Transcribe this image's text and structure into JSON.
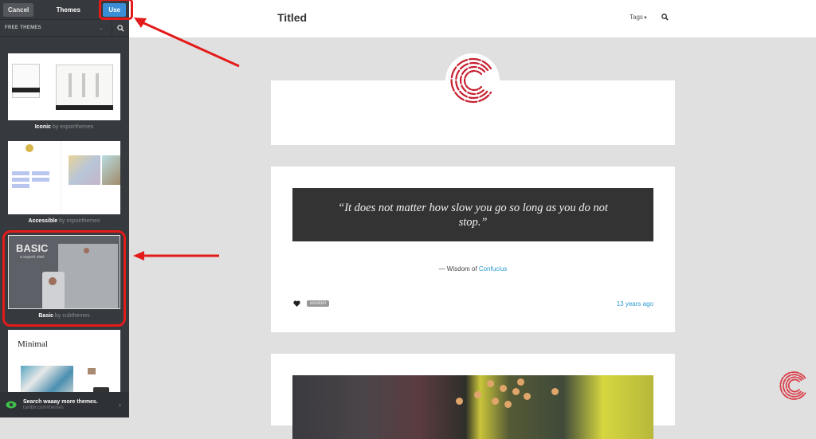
{
  "sidebar": {
    "cancel_label": "Cancel",
    "title": "Themes",
    "use_label": "Use",
    "filter_label": "FREE THEMES",
    "themes": [
      {
        "name": "Iconic",
        "by": "by",
        "author": "espoirthemes"
      },
      {
        "name": "Accessible",
        "by": "by",
        "author": "espoirthemes"
      },
      {
        "name": "Basic",
        "by": "by",
        "author": "cubthemes",
        "thumb_title": "BASIC",
        "thumb_subtitle": "a superb start"
      },
      {
        "name": "Minimal",
        "thumb_title": "Minimal"
      }
    ],
    "promo": {
      "title": "Search waaay more themes.",
      "subtitle": "tumblr.com/themes"
    }
  },
  "header": {
    "blog_title": "Titled",
    "tags_label": "Tags"
  },
  "post": {
    "quote": "“It does not matter how slow you go so long as you do not stop.”",
    "attribution_prefix": "— Wisdom of",
    "attribution_link": "Confucius",
    "tag": "wisdom",
    "time": "13 years ago"
  },
  "colors": {
    "accent_blue": "#3a8ed6",
    "link_blue": "#2d9ad3",
    "annotation_red": "#e41b1b",
    "logo_red": "#c62030"
  }
}
